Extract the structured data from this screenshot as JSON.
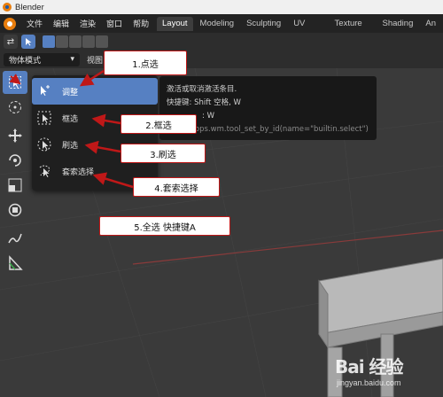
{
  "window": {
    "title": "Blender"
  },
  "menu": {
    "items": [
      "文件",
      "编辑",
      "渲染",
      "窗口",
      "帮助"
    ],
    "tabs": [
      "Layout",
      "Modeling",
      "Sculpting",
      "UV Editing",
      "Texture Paint",
      "Shading",
      "An"
    ]
  },
  "header": {
    "mode_dropdown": "物体模式",
    "view_label": "视图"
  },
  "flyout": {
    "items": [
      {
        "label": "调整",
        "icon": "tweak-icon"
      },
      {
        "label": "框选",
        "icon": "box-select-icon"
      },
      {
        "label": "刷选",
        "icon": "circle-select-icon"
      },
      {
        "label": "套索选择",
        "icon": "lasso-select-icon"
      }
    ]
  },
  "tooltip": {
    "line1": "激活或取消激活条目.",
    "line2": "快捷键: Shift 空格, W",
    "line3": ": W",
    "line4": "py.ops.wm.tool_set_by_id(name=\"builtin.select\")"
  },
  "callouts": {
    "c1": "1.点选",
    "c2": "2.框选",
    "c3": "3.刷选",
    "c4": "4.套索选择",
    "c5": "5.全选   快捷键A"
  },
  "watermark": {
    "main": "Bai 经验",
    "sub": "jingyan.baidu.com"
  },
  "colors": {
    "accent": "#5680c2",
    "callout_border": "#c01818",
    "axis_red": "#8a3a3a"
  }
}
